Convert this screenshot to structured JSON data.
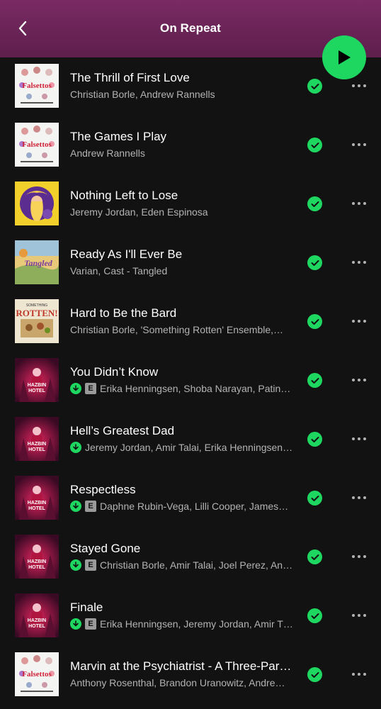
{
  "header": {
    "title": "On Repeat"
  },
  "colors": {
    "accent": "#1ed760",
    "header_bg": "#6b2458",
    "bg": "#121212"
  },
  "tracks": [
    {
      "title": "The Thrill of First Love",
      "artists": "Christian Borle, Andrew Rannells",
      "downloaded": false,
      "explicit": false,
      "art": "falsettos"
    },
    {
      "title": "The Games I Play",
      "artists": "Andrew Rannells",
      "downloaded": false,
      "explicit": false,
      "art": "falsettos"
    },
    {
      "title": "Nothing Left to Lose",
      "artists": "Jeremy Jordan, Eden Espinosa",
      "downloaded": false,
      "explicit": false,
      "art": "rapunzel"
    },
    {
      "title": "Ready As I'll Ever Be",
      "artists": "Varian, Cast - Tangled",
      "downloaded": false,
      "explicit": false,
      "art": "tangled"
    },
    {
      "title": "Hard to Be the Bard",
      "artists": "Christian Borle, 'Something Rotten' Ensemble,…",
      "downloaded": false,
      "explicit": false,
      "art": "rotten"
    },
    {
      "title": "You Didn’t Know",
      "artists": "Erika Henningsen, Shoba Narayan, Patina…",
      "downloaded": true,
      "explicit": true,
      "art": "hazbin"
    },
    {
      "title": "Hell’s Greatest Dad",
      "artists": "Jeremy Jordan, Amir Talai, Erika Henningsen…",
      "downloaded": true,
      "explicit": false,
      "art": "hazbin"
    },
    {
      "title": "Respectless",
      "artists": "Daphne Rubin-Vega, Lilli Cooper, James…",
      "downloaded": true,
      "explicit": true,
      "art": "hazbin"
    },
    {
      "title": "Stayed Gone",
      "artists": "Christian Borle, Amir Talai, Joel Perez, An…",
      "downloaded": true,
      "explicit": true,
      "art": "hazbin"
    },
    {
      "title": "Finale",
      "artists": "Erika Henningsen, Jeremy Jordan, Amir T…",
      "downloaded": true,
      "explicit": true,
      "art": "hazbin"
    },
    {
      "title": "Marvin at the Psychiatrist - A Three-Part…",
      "artists": "Anthony Rosenthal, Brandon Uranowitz, Andre…",
      "downloaded": false,
      "explicit": false,
      "art": "falsettos"
    }
  ],
  "labels": {
    "explicit_badge": "E"
  },
  "album_art_text": {
    "falsettos": "Falsettos",
    "tangled": "Tangled",
    "rotten": "ROTTEN!",
    "hazbin": "HAZBIN HOTEL"
  }
}
